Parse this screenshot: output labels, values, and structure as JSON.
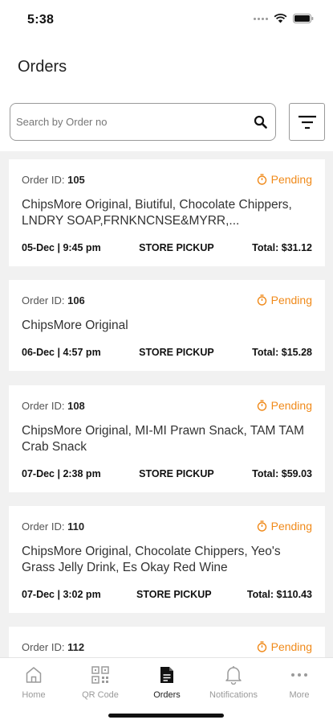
{
  "status_bar": {
    "time": "5:38"
  },
  "page": {
    "title": "Orders"
  },
  "search": {
    "placeholder": "Search by Order no",
    "value": ""
  },
  "colors": {
    "accent": "#f08a1a",
    "list_background": "#f1f1f1"
  },
  "orders": [
    {
      "id_label": "Order ID:",
      "id": "105",
      "status": "Pending",
      "items": "ChipsMore Original, Biutiful, Chocolate Chippers, LNDRY SOAP,FRNKNCNSE&MYRR,...",
      "date_time": "05-Dec | 9:45 pm",
      "method": "STORE PICKUP",
      "total": "Total: $31.12"
    },
    {
      "id_label": "Order ID:",
      "id": "106",
      "status": "Pending",
      "items": "ChipsMore Original",
      "date_time": "06-Dec | 4:57 pm",
      "method": "STORE PICKUP",
      "total": "Total: $15.28"
    },
    {
      "id_label": "Order ID:",
      "id": "108",
      "status": "Pending",
      "items": "ChipsMore Original, MI-MI Prawn Snack, TAM TAM Crab Snack",
      "date_time": "07-Dec | 2:38 pm",
      "method": "STORE PICKUP",
      "total": "Total: $59.03"
    },
    {
      "id_label": "Order ID:",
      "id": "110",
      "status": "Pending",
      "items": "ChipsMore Original, Chocolate Chippers, Yeo's Grass Jelly Drink, Es Okay Red Wine",
      "date_time": "07-Dec | 3:02 pm",
      "method": "STORE PICKUP",
      "total": "Total: $110.43"
    },
    {
      "id_label": "Order ID:",
      "id": "112",
      "status": "Pending"
    }
  ],
  "tabs": [
    {
      "label": "Home",
      "icon": "home-icon"
    },
    {
      "label": "QR Code",
      "icon": "qr-code-icon"
    },
    {
      "label": "Orders",
      "icon": "orders-icon",
      "active": true
    },
    {
      "label": "Notifications",
      "icon": "bell-icon"
    },
    {
      "label": "More",
      "icon": "more-icon"
    }
  ]
}
